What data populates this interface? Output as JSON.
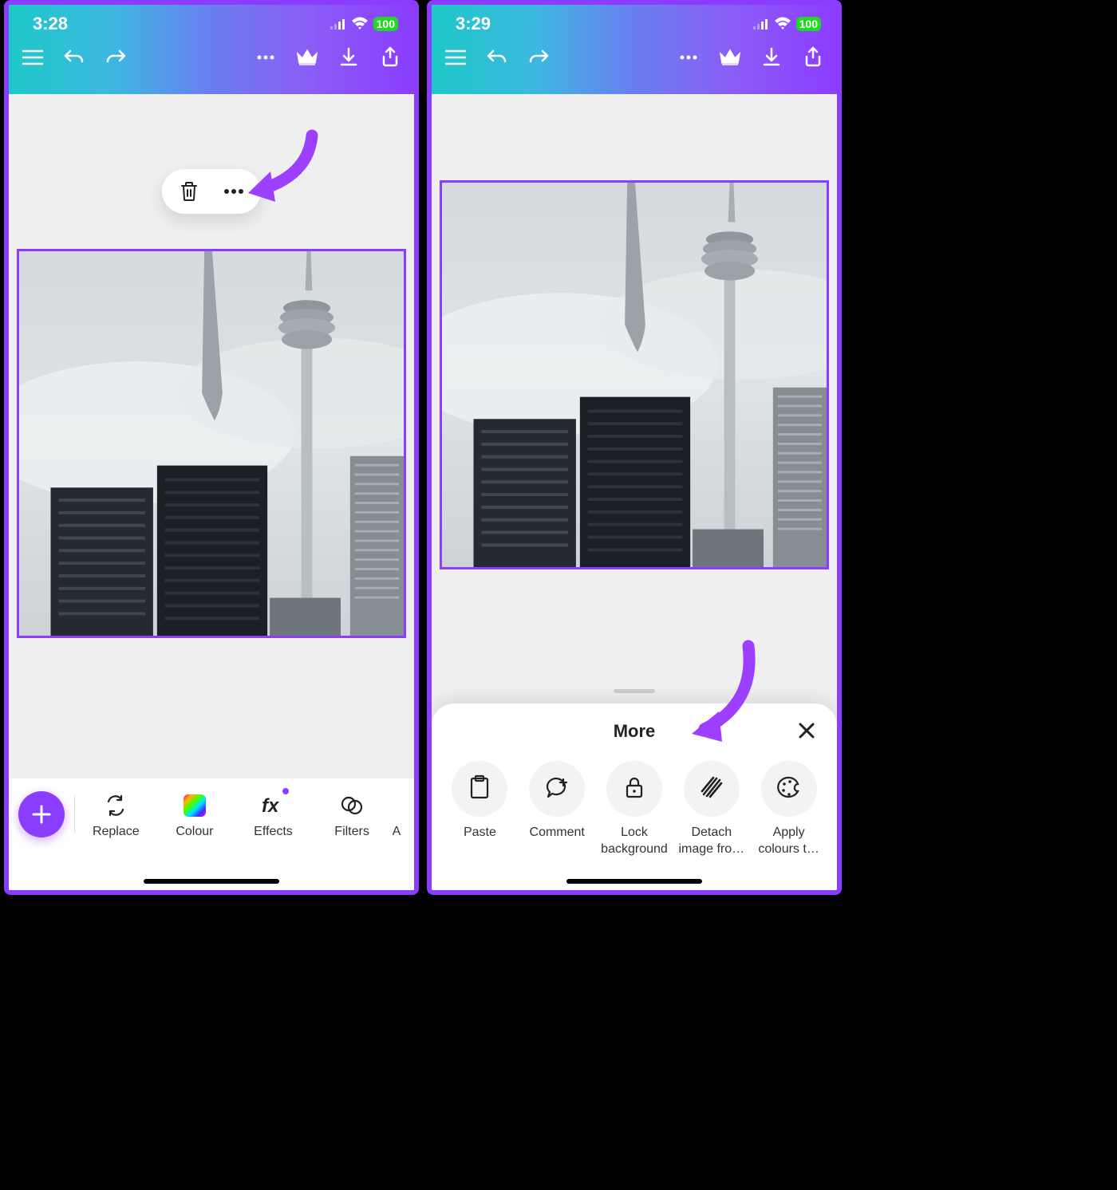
{
  "left": {
    "status_time": "3:28",
    "battery": "100",
    "toolbar": {
      "items": [
        {
          "label": "Replace"
        },
        {
          "label": "Colour"
        },
        {
          "label": "Effects"
        },
        {
          "label": "Filters"
        },
        {
          "label": "A"
        }
      ]
    }
  },
  "right": {
    "status_time": "3:29",
    "battery": "100",
    "panel": {
      "title": "More",
      "items": [
        {
          "label": "Paste"
        },
        {
          "label": "Comment"
        },
        {
          "label": "Lock background"
        },
        {
          "label": "Detach image fro…"
        },
        {
          "label": "Apply colours t…"
        }
      ]
    }
  }
}
